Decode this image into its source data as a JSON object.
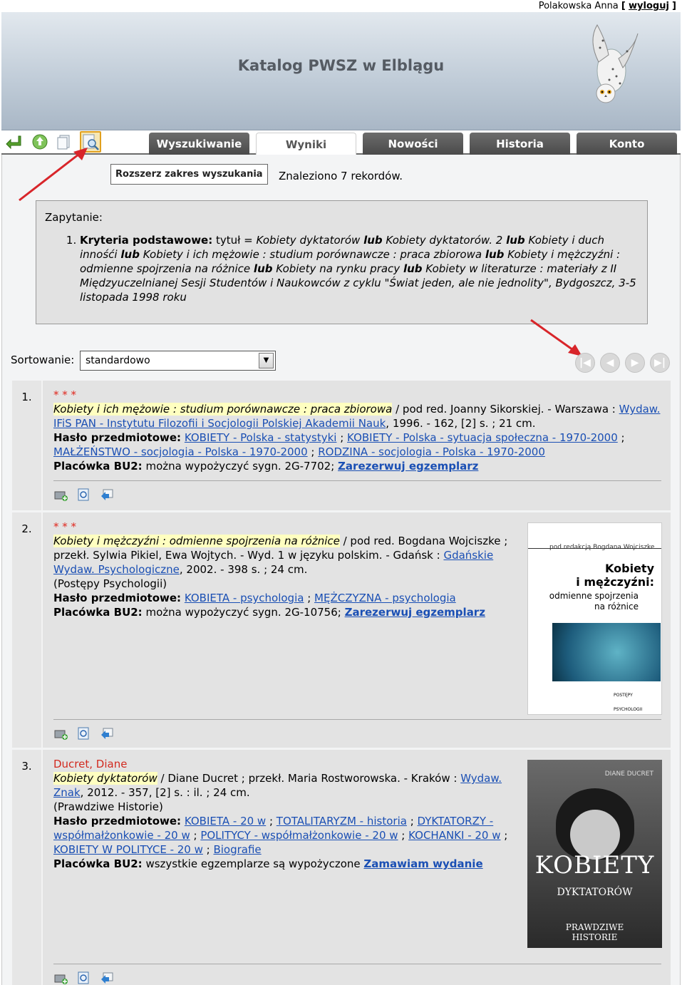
{
  "user": {
    "name": "Polakowska Anna",
    "open": "[",
    "logout": "wyloguj",
    "close": "]"
  },
  "header": {
    "title": "Katalog PWSZ w Elblągu"
  },
  "toolbar_icons": [
    "return-icon",
    "refresh-icon",
    "copy-icon",
    "extend-search-icon"
  ],
  "tabs": [
    {
      "label": "Wyszukiwanie",
      "active": false
    },
    {
      "label": "Wyniki",
      "active": true
    },
    {
      "label": "Nowości",
      "active": false
    },
    {
      "label": "Historia",
      "active": false
    },
    {
      "label": "Konto",
      "active": false
    }
  ],
  "extend_button": "Rozszerz zakres wyszukania",
  "found_text": "Znaleziono 7 rekordów.",
  "query": {
    "label": "Zapytanie:",
    "criteria_label": "Kryteria podstawowe:",
    "field": "tytuł =",
    "terms": [
      "Kobiety dyktatorów",
      "Kobiety dyktatorów. 2",
      "Kobiety i duch innośći",
      "Kobiety i ich mężowie : studium porównawcze : praca zbiorowa",
      "Kobiety i mężczyźni : odmienne spojrzenia na różnice",
      "Kobiety na rynku pracy",
      "Kobiety w literaturze : materiały z II Międzyuczelnianej Sesji Studentów i Naukowców z cyklu \"Świat jeden, ale nie jednolity\", Bydgoszcz, 3-5 listopada 1998 roku"
    ],
    "operator": "lub"
  },
  "sort": {
    "label": "Sortowanie:",
    "value": "standardowo"
  },
  "pager": [
    "first-page-icon",
    "prev-page-icon",
    "next-page-icon",
    "last-page-icon"
  ],
  "records": [
    {
      "num": "1.",
      "stars": "* * *",
      "title": "Kobiety i ich mężowie : studium porównawcze : praca zbiorowa",
      "resp": " / pod red. Joanny Sikorskiej. - Warszawa :",
      "publisher": "Wydaw. IFiS PAN - Instytutu Filozofii i Socjologii Polskiej Akademii Nauk",
      "pub_rest": ", 1996. - 162, [2] s. ; 21 cm.",
      "subject_label": "Hasło przedmiotowe:",
      "subjects": [
        "KOBIETY - Polska - statystyki",
        "KOBIETY - Polska - sytuacja społeczna - 1970-2000",
        "MAŁŻEŃSTWO - socjologia - Polska - 1970-2000",
        "RODZINA - socjologia - Polska - 1970-2000"
      ],
      "holding_label": "Placówka BU2:",
      "holding_text": " można wypożyczyć sygn. 2G-7702;",
      "action": "Zarezerwuj egzemplarz"
    },
    {
      "num": "2.",
      "stars": "* * *",
      "title": "Kobiety i mężczyźni : odmienne spojrzenia na różnice",
      "resp": " / pod red. Bogdana Wojciszke ;",
      "resp2": "przekł. Sylwia Pikiel, Ewa Wojtych. - Wyd. 1 w języku polskim. - Gdańsk :",
      "publisher": "Gdańskie Wydaw. Psychologiczne",
      "pub_rest": ", 2002. - 398 s. ; 24 cm.",
      "series": "(Postępy Psychologii)",
      "subject_label": "Hasło przedmiotowe:",
      "subjects": [
        "KOBIETA - psychologia",
        "MĘŻCZYZNA - psychologia"
      ],
      "holding_label": "Placówka BU2:",
      "holding_text": " można wypożyczyć sygn. 2G-10756;",
      "action": "Zarezerwuj egzemplarz",
      "cover": {
        "editor": "pod redakcją  Bogdana Wojciszke",
        "title1": "Kobiety",
        "title2": "i mężczyźni:",
        "sub1": "odmienne spojrzenia",
        "sub2": "na różnice",
        "series": "POSTĘPY PSYCHOLOGII"
      }
    },
    {
      "num": "3.",
      "author": "Ducret, Diane",
      "title": "Kobiety dyktatorów",
      "resp": " / Diane Ducret ; przekł. Maria Rostworowska. - Kraków :",
      "publisher": "Wydaw. Znak",
      "pub_rest": ", 2012. - 357, [2] s. : il. ; 24 cm.",
      "series": "(Prawdziwe Historie)",
      "subject_label": "Hasło przedmiotowe:",
      "subjects": [
        "KOBIETA - 20 w",
        "TOTALITARYZM - historia",
        "DYKTATORZY - współmałżonkowie - 20 w",
        "POLITYCY - współmałżonkowie - 20 w",
        "KOCHANKI - 20 w",
        "KOBIETY W POLITYCE - 20 w",
        "Biografie"
      ],
      "holding_label": "Placówka BU2:",
      "holding_text": " wszystkie egzemplarze są wypożyczone",
      "action": "Zamawiam wydanie",
      "cover": {
        "author": "DIANE DUCRET",
        "title1": "KOBIETY",
        "title2": "DYKTATORÓW",
        "series1": "PRAWDZIWE",
        "series2": "HISTORIE"
      }
    }
  ],
  "record_icons": [
    "add-to-basket-icon",
    "details-icon",
    "export-icon"
  ],
  "colors": {
    "link": "#1a4fb4",
    "highlight": "#ffffc0",
    "author": "#d22a1f",
    "tab": "#5a5a5a"
  }
}
